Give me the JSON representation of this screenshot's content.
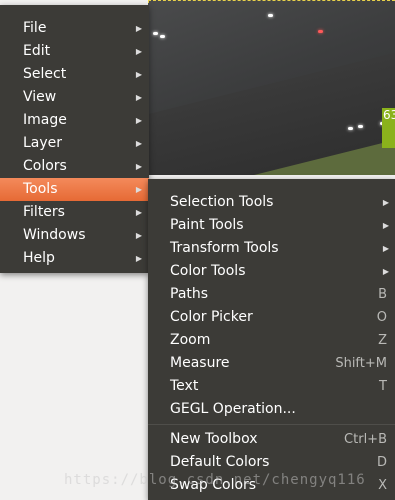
{
  "colors": {
    "menu_bg": "#3c3b37",
    "active": "#ed7442",
    "shortcut": "#b9b9b6"
  },
  "main_menu": {
    "items": [
      {
        "label": "File",
        "has_submenu": true
      },
      {
        "label": "Edit",
        "has_submenu": true
      },
      {
        "label": "Select",
        "has_submenu": true
      },
      {
        "label": "View",
        "has_submenu": true
      },
      {
        "label": "Image",
        "has_submenu": true
      },
      {
        "label": "Layer",
        "has_submenu": true
      },
      {
        "label": "Colors",
        "has_submenu": true
      },
      {
        "label": "Tools",
        "has_submenu": true,
        "active": true
      },
      {
        "label": "Filters",
        "has_submenu": true
      },
      {
        "label": "Windows",
        "has_submenu": true
      },
      {
        "label": "Help",
        "has_submenu": true
      }
    ]
  },
  "tools_submenu": {
    "items": [
      {
        "label": "Selection Tools",
        "shortcut": ""
      },
      {
        "label": "Paint Tools",
        "shortcut": ""
      },
      {
        "label": "Transform Tools",
        "shortcut": ""
      },
      {
        "label": "Color Tools",
        "shortcut": ""
      },
      {
        "label": "Paths",
        "shortcut": "B"
      },
      {
        "label": "Color Picker",
        "shortcut": "O"
      },
      {
        "label": "Zoom",
        "shortcut": "Z"
      },
      {
        "label": "Measure",
        "shortcut": "Shift+M"
      },
      {
        "label": "Text",
        "shortcut": "T"
      },
      {
        "label": "GEGL Operation...",
        "shortcut": ""
      },
      {
        "label": "New Toolbox",
        "shortcut": "Ctrl+B"
      },
      {
        "label": "Default Colors",
        "shortcut": "D"
      },
      {
        "label": "Swap Colors",
        "shortcut": "X"
      }
    ]
  },
  "canvas": {
    "tag_text": "63"
  },
  "watermark": "https://blog.csdn.net/chengyq116"
}
